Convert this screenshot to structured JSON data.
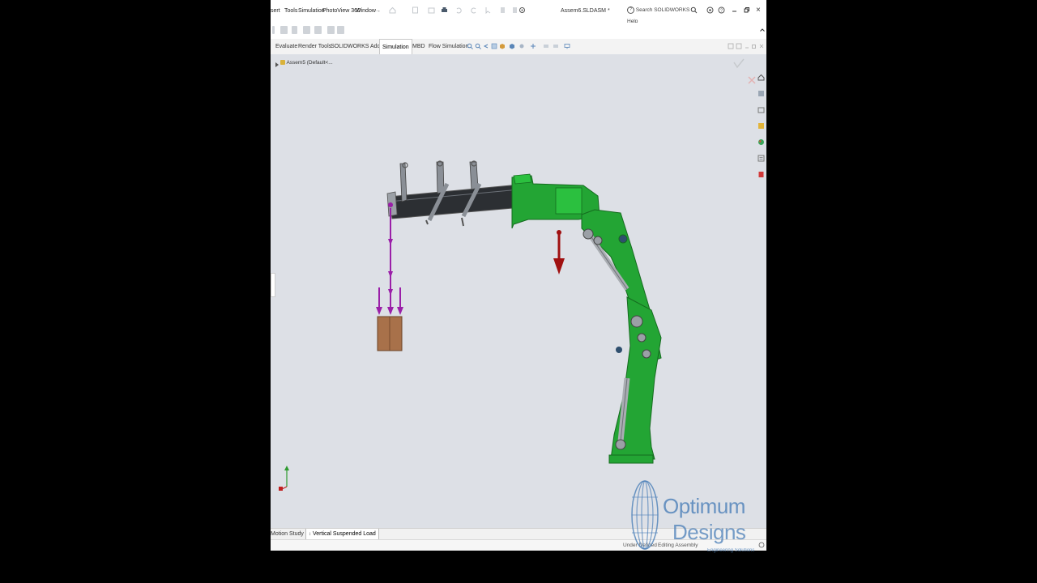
{
  "menu": {
    "items": [
      "sert",
      "Tools",
      "Simulation",
      "PhotoView 360",
      "Window"
    ]
  },
  "window": {
    "file_title": "Assem6.SLDASM *",
    "search_placeholder": "Search SOLIDWORKS Help",
    "minimize_icon": "minimize-icon",
    "restore_icon": "restore-icon",
    "close_label": "×"
  },
  "command_tabs": {
    "items": [
      {
        "label": "Evaluate",
        "active": false
      },
      {
        "label": "Render Tools",
        "active": false
      },
      {
        "label": "SOLIDWORKS Add-Ins",
        "active": false
      },
      {
        "label": "Simulation",
        "active": true
      },
      {
        "label": "MBD",
        "active": false
      },
      {
        "label": "Flow Simulation",
        "active": false
      }
    ]
  },
  "feature_tree": {
    "root_label": "Assem5 (Default<..."
  },
  "bottom_tabs": {
    "items": [
      {
        "label": "Motion Study 1",
        "active": false
      },
      {
        "label": "Vertical Suspended Load",
        "active": true
      }
    ]
  },
  "status": {
    "left": "Under Defined",
    "right": "Editing Assembly"
  },
  "watermark": {
    "line1": "Optimum",
    "line2": "Designs",
    "tagline": "Engineering Solutions"
  },
  "colors": {
    "crane_green": "#23a534",
    "boom_dark": "#2c2f33",
    "load_force": "#9a1fa8",
    "gravity": "#a01010",
    "box": "#a8714a",
    "viewport_bg": "#dde0e6",
    "accent_blue": "#4b7fb8"
  }
}
